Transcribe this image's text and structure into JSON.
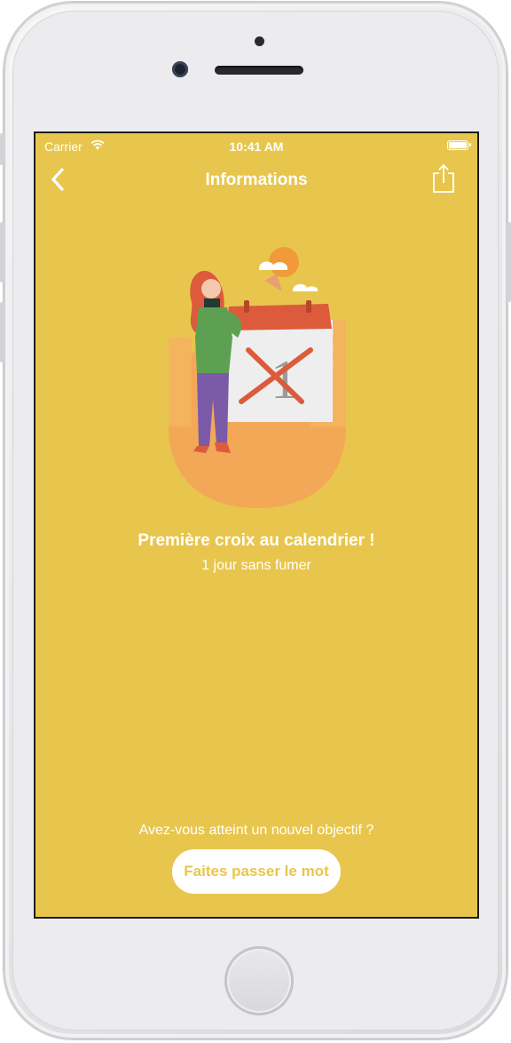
{
  "colors": {
    "background": "#e8c64d",
    "accent_orange": "#f2a857",
    "calendar_red": "#dc5b3c",
    "button_text": "#e8c64d"
  },
  "status_bar": {
    "carrier": "Carrier",
    "time": "10:41 AM",
    "icons": [
      "wifi-icon",
      "battery-icon"
    ]
  },
  "nav": {
    "back_icon": "chevron-left-icon",
    "title": "Informations",
    "share_icon": "share-icon"
  },
  "illustration": {
    "calendar_number": "1",
    "description_icons": [
      "woman-figure",
      "calendar-icon",
      "sun-icon",
      "cloud-icon"
    ]
  },
  "achievement": {
    "title": "Première croix au calendrier !",
    "subtitle": "1 jour sans fumer"
  },
  "footer": {
    "question": "Avez-vous atteint un nouvel objectif ?",
    "share_button_label": "Faites passer le mot"
  }
}
